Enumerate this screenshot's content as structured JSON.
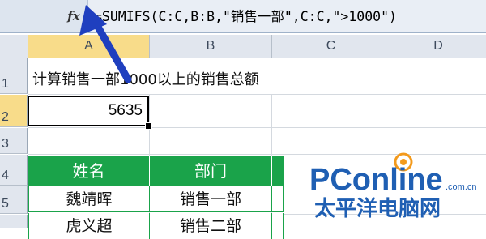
{
  "formula_bar": {
    "fx_label": "fx",
    "formula": "=SUMIFS(C:C,B:B,\"销售一部\",C:C,\">1000\")"
  },
  "columns": [
    "A",
    "B",
    "C",
    "D"
  ],
  "rows": [
    "1",
    "2",
    "3",
    "4",
    "5"
  ],
  "cells": {
    "a1": "计算销售一部1000以上的销售总额",
    "a2": "5635"
  },
  "table": {
    "headers": [
      "姓名",
      "部门"
    ],
    "rows": [
      [
        "魏靖晖",
        "销售一部"
      ],
      [
        "虎义超",
        "销售二部"
      ]
    ],
    "header_color": "#1aa34a"
  },
  "watermark": {
    "brand": "PConline",
    "domain": ".com.cn",
    "chinese": "太平洋电脑网"
  },
  "colors": {
    "accent_green": "#1aa34a",
    "arrow_blue": "#1f3fbf",
    "active_header": "#f8dc8a",
    "brand_blue": "#1f5fb3",
    "brand_orange": "#f39a1c"
  }
}
